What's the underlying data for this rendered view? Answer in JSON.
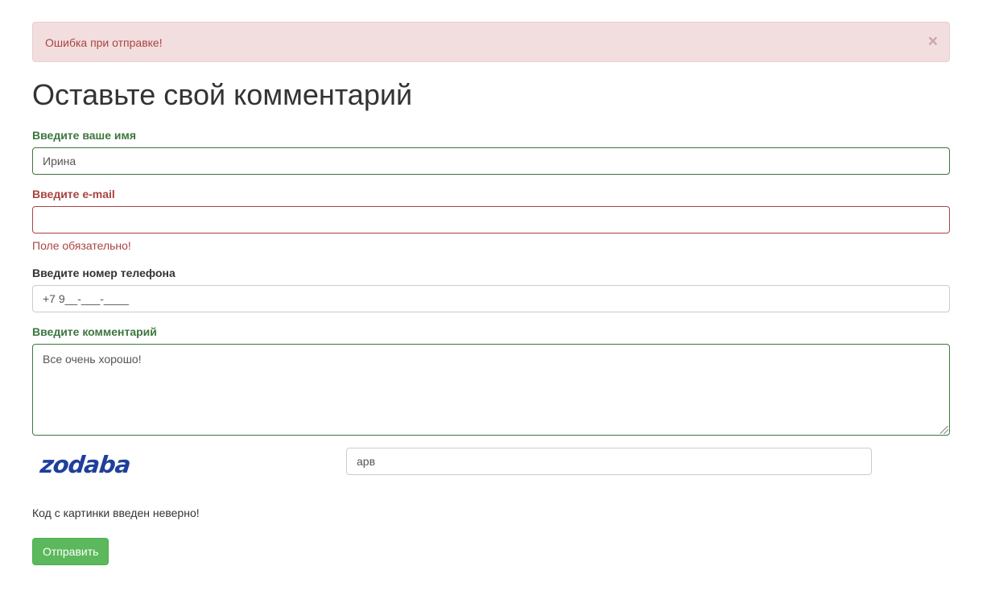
{
  "alert": {
    "message": "Ошибка при отправке!",
    "close_glyph": "×"
  },
  "page_title": "Оставьте свой комментарий",
  "form": {
    "name": {
      "label": "Введите ваше имя",
      "value": "Ирина",
      "state": "success"
    },
    "email": {
      "label": "Введите e-mail",
      "value": "",
      "state": "error",
      "error": "Поле обязательно!"
    },
    "phone": {
      "label": "Введите номер телефона",
      "value": "+7 9__-___-____"
    },
    "comment": {
      "label": "Введите комментарий",
      "value": "Все очень хорошо!",
      "state": "success"
    },
    "captcha": {
      "image_text": "zodaba",
      "value": "арв",
      "error": "Код с картинки введен неверно!"
    },
    "submit_label": "Отправить"
  },
  "colors": {
    "success": "#3c763d",
    "error": "#a94442",
    "alert_bg": "#f2dede",
    "button": "#5cb85c",
    "captcha": "#1f3f9a"
  }
}
